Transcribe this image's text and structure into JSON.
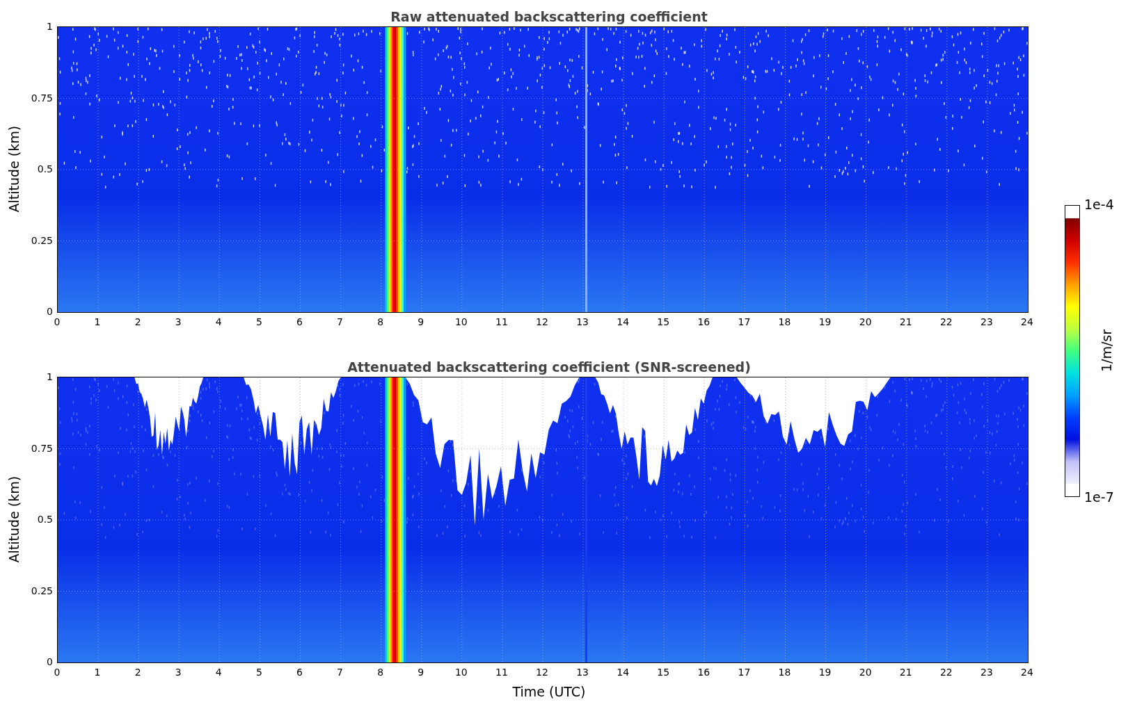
{
  "panels": [
    {
      "title": "Raw attenuated backscattering coefficient",
      "ylabel": "Altitude (km)",
      "yticks": [
        "1",
        "0.75",
        "0.5",
        "0.25",
        "0"
      ],
      "xticks": [
        "0",
        "1",
        "2",
        "3",
        "4",
        "5",
        "6",
        "7",
        "8",
        "9",
        "10",
        "11",
        "12",
        "13",
        "14",
        "15",
        "16",
        "17",
        "18",
        "19",
        "20",
        "21",
        "22",
        "23",
        "24"
      ],
      "screened": false
    },
    {
      "title": "Attenuated backscattering coefficient (SNR-screened)",
      "ylabel": "Altitude (km)",
      "yticks": [
        "1",
        "0.75",
        "0.5",
        "0.25",
        "0"
      ],
      "xticks": [
        "0",
        "1",
        "2",
        "3",
        "4",
        "5",
        "6",
        "7",
        "8",
        "9",
        "10",
        "11",
        "12",
        "13",
        "14",
        "15",
        "16",
        "17",
        "18",
        "19",
        "20",
        "21",
        "22",
        "23",
        "24"
      ],
      "xlabel": "Time (UTC)",
      "screened": true
    }
  ],
  "colorbar": {
    "max": "1e-4",
    "min": "1e-7",
    "label": "1/m/sr"
  }
}
